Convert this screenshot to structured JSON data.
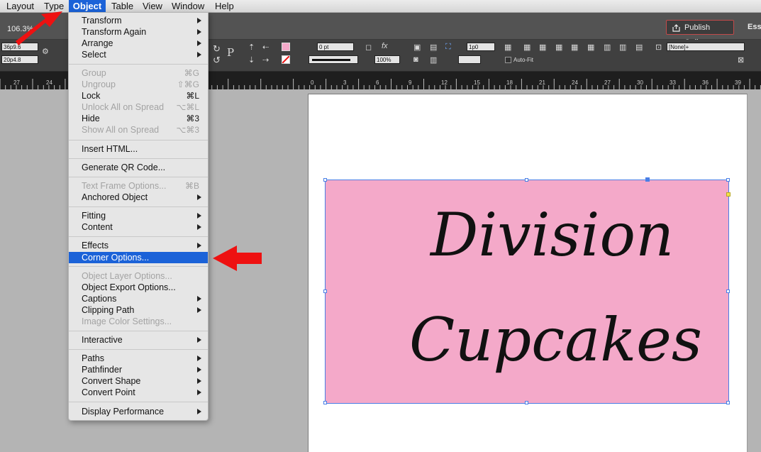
{
  "menubar": {
    "items": [
      "Layout",
      "Type",
      "Object",
      "Table",
      "View",
      "Window",
      "Help"
    ],
    "active": "Object"
  },
  "appbar": {
    "zoom": "106.3%",
    "publish_label": "Publish Online",
    "workspace": "Essentials"
  },
  "controlbar": {
    "x_value": "36p9.6",
    "y_value": "20p4.8",
    "stroke_weight": "0 pt",
    "opacity": "100%",
    "spacing_value": "1p0",
    "autofit_label": "Auto-Fit",
    "style_value": "[None]+",
    "fill_color": "#f4a9c9"
  },
  "ruler": {
    "labels": [
      "27",
      "24",
      "0",
      "3",
      "6",
      "9",
      "12",
      "15",
      "18",
      "21",
      "24",
      "27",
      "30",
      "33",
      "36",
      "39"
    ]
  },
  "document": {
    "frame_fill": "#f4a9c9",
    "line1": "Division",
    "line2": "Cupcakes"
  },
  "menu": {
    "items": [
      {
        "label": "Transform",
        "shortcut": "",
        "submenu": true,
        "disabled": false
      },
      {
        "label": "Transform Again",
        "shortcut": "",
        "submenu": true,
        "disabled": false
      },
      {
        "label": "Arrange",
        "shortcut": "",
        "submenu": true,
        "disabled": false
      },
      {
        "label": "Select",
        "shortcut": "",
        "submenu": true,
        "disabled": false
      },
      {
        "label": "Group",
        "shortcut": "⌘G",
        "submenu": false,
        "disabled": true
      },
      {
        "label": "Ungroup",
        "shortcut": "⇧⌘G",
        "submenu": false,
        "disabled": true
      },
      {
        "label": "Lock",
        "shortcut": "⌘L",
        "submenu": false,
        "disabled": false
      },
      {
        "label": "Unlock All on Spread",
        "shortcut": "⌥⌘L",
        "submenu": false,
        "disabled": true
      },
      {
        "label": "Hide",
        "shortcut": "⌘3",
        "submenu": false,
        "disabled": false
      },
      {
        "label": "Show All on Spread",
        "shortcut": "⌥⌘3",
        "submenu": false,
        "disabled": true
      },
      {
        "label": "Insert HTML...",
        "shortcut": "",
        "submenu": false,
        "disabled": false
      },
      {
        "label": "Generate QR Code...",
        "shortcut": "",
        "submenu": false,
        "disabled": false
      },
      {
        "label": "Text Frame Options...",
        "shortcut": "⌘B",
        "submenu": false,
        "disabled": true
      },
      {
        "label": "Anchored Object",
        "shortcut": "",
        "submenu": true,
        "disabled": false
      },
      {
        "label": "Fitting",
        "shortcut": "",
        "submenu": true,
        "disabled": false
      },
      {
        "label": "Content",
        "shortcut": "",
        "submenu": true,
        "disabled": false
      },
      {
        "label": "Effects",
        "shortcut": "",
        "submenu": true,
        "disabled": false
      },
      {
        "label": "Corner Options...",
        "shortcut": "",
        "submenu": false,
        "disabled": false
      },
      {
        "label": "Object Layer Options...",
        "shortcut": "",
        "submenu": false,
        "disabled": true
      },
      {
        "label": "Object Export Options...",
        "shortcut": "",
        "submenu": false,
        "disabled": false
      },
      {
        "label": "Captions",
        "shortcut": "",
        "submenu": true,
        "disabled": false
      },
      {
        "label": "Clipping Path",
        "shortcut": "",
        "submenu": true,
        "disabled": false
      },
      {
        "label": "Image Color Settings...",
        "shortcut": "",
        "submenu": false,
        "disabled": true
      },
      {
        "label": "Interactive",
        "shortcut": "",
        "submenu": true,
        "disabled": false
      },
      {
        "label": "Paths",
        "shortcut": "",
        "submenu": true,
        "disabled": false
      },
      {
        "label": "Pathfinder",
        "shortcut": "",
        "submenu": true,
        "disabled": false
      },
      {
        "label": "Convert Shape",
        "shortcut": "",
        "submenu": true,
        "disabled": false
      },
      {
        "label": "Convert Point",
        "shortcut": "",
        "submenu": true,
        "disabled": false
      },
      {
        "label": "Display Performance",
        "shortcut": "",
        "submenu": true,
        "disabled": false
      }
    ],
    "highlighted": "Corner Options...",
    "highlight_color": "#1b62d8"
  },
  "annotations": {
    "arrow_color": "#ee1111"
  }
}
